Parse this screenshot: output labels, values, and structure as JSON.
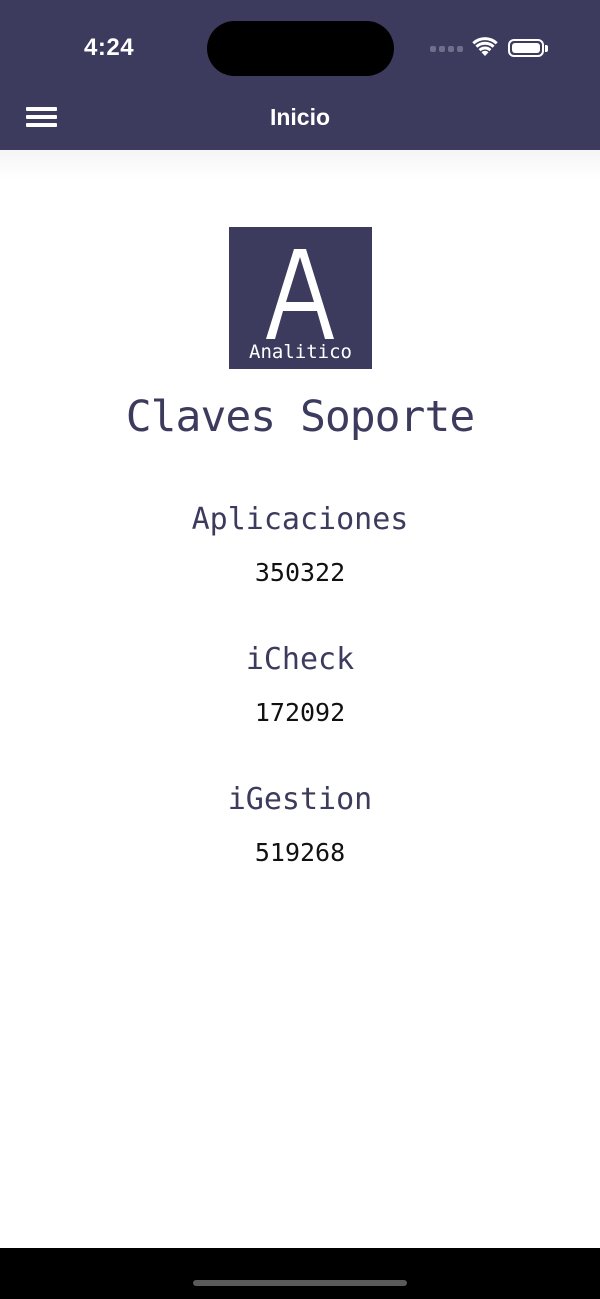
{
  "status_bar": {
    "time": "4:24"
  },
  "nav": {
    "title": "Inicio",
    "menu_icon": "hamburger-menu-icon"
  },
  "logo": {
    "letter": "A",
    "caption": "Analitico"
  },
  "page": {
    "title": "Claves Soporte"
  },
  "keys": [
    {
      "label": "Aplicaciones",
      "value": "350322"
    },
    {
      "label": "iCheck",
      "value": "172092"
    },
    {
      "label": "iGestion",
      "value": "519268"
    }
  ],
  "colors": {
    "header": "#3c3b5e",
    "text_accent": "#3c3b5e",
    "background": "#ffffff"
  }
}
